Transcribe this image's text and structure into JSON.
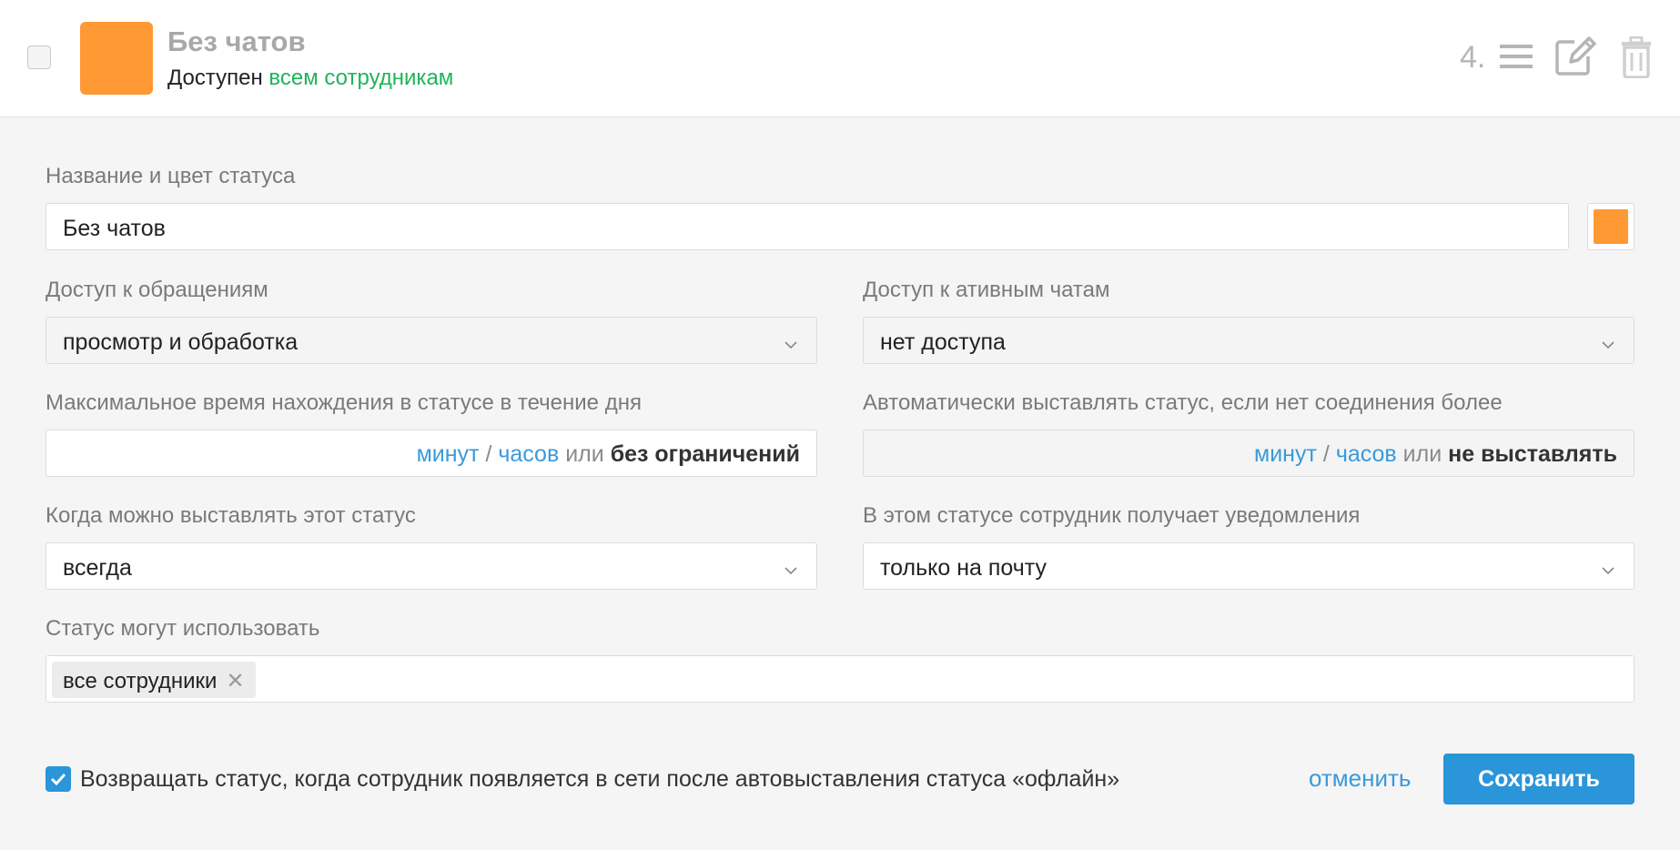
{
  "header": {
    "title": "Без чатов",
    "subtitle_prefix": "Доступен",
    "subtitle_highlight": "всем сотрудникам",
    "order": "4.",
    "status_color": "#ff9933",
    "icons": [
      "reorder-icon",
      "edit-icon",
      "trash-icon"
    ]
  },
  "form": {
    "name_label": "Название и цвет статуса",
    "name_value": "Без чатов",
    "color": "#ff9933",
    "appeals_label": "Доступ к обращениям",
    "appeals_value": "просмотр и обработка",
    "chats_label": "Доступ к ативным чатам",
    "chats_value": "нет доступа",
    "max_time_label": "Максимальное время нахождения в статусе в течение дня",
    "max_time": {
      "minutes": "минут",
      "slash": "/",
      "hours": "часов",
      "or": "или",
      "option": "без ограничений"
    },
    "auto_label": "Автоматически выставлять статус, если нет соединения более",
    "auto": {
      "minutes": "минут",
      "slash": "/",
      "hours": "часов",
      "or": "или",
      "option": "не выставлять"
    },
    "when_label": "Когда можно выставлять этот статус",
    "when_value": "всегда",
    "notify_label": "В этом статусе сотрудник получает уведомления",
    "notify_value": "только на почту",
    "users_label": "Статус могут использовать",
    "users_tag": "все сотрудники",
    "remove_glyph": "✕",
    "return_checkbox_label": "Возвращать статус, когда сотрудник появляется в сети после автовыставления статуса «офлайн»",
    "return_checked": true
  },
  "actions": {
    "cancel": "отменить",
    "save": "Сохранить"
  }
}
